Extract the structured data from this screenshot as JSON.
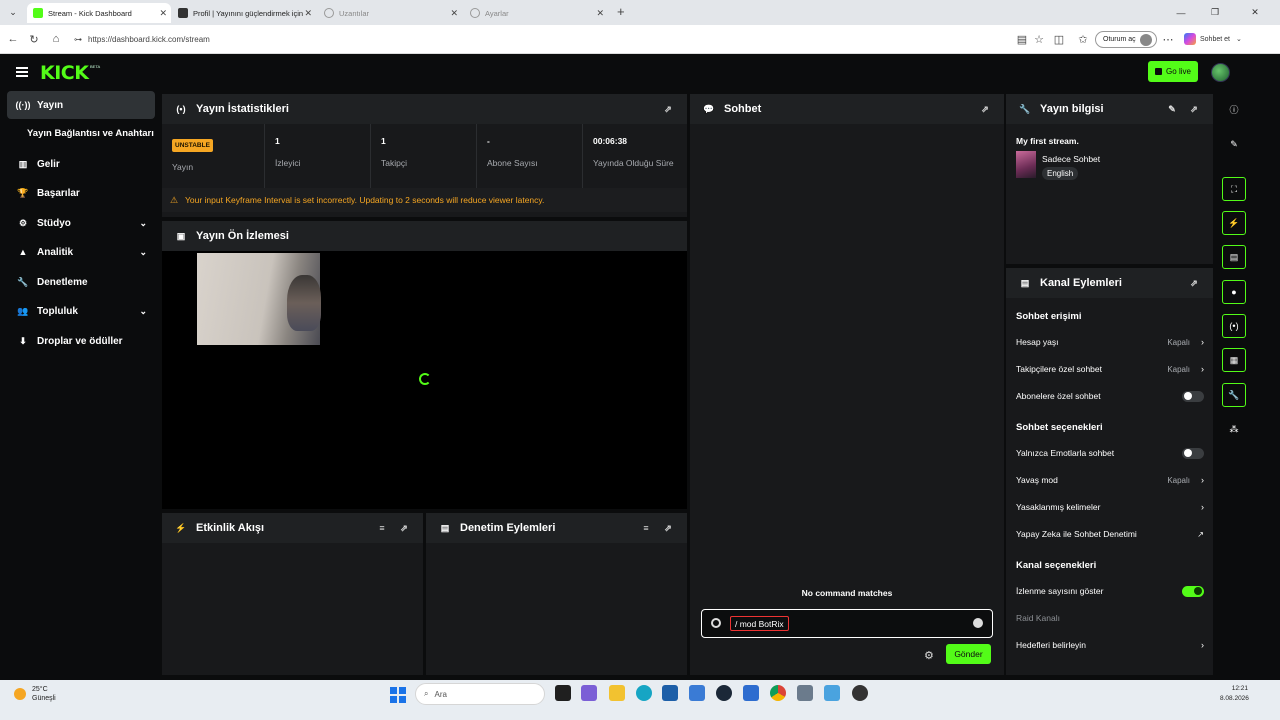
{
  "browser": {
    "tabs": [
      {
        "title": "Stream - Kick Dashboard",
        "active": true
      },
      {
        "title": "Profil | Yayınını güçlendirmek için ♪",
        "active": false
      },
      {
        "title": "Uzantılar",
        "active": false
      },
      {
        "title": "Ayarlar",
        "active": false
      }
    ],
    "url": "https://dashboard.kick.com/stream",
    "signin_label": "Oturum aç",
    "copilot_label": "Sohbet et"
  },
  "app": {
    "logo": "KICK",
    "logo_badge": "BETA",
    "go_live_label": "Go live",
    "accent_color": "#53fc18"
  },
  "sidebar": {
    "items": [
      {
        "label": "Yayın",
        "icon": "broadcast-icon",
        "active": true
      },
      {
        "label": "Yayın Bağlantısı ve Anahtarı",
        "sub": true
      },
      {
        "label": "Gelir",
        "icon": "chart-icon"
      },
      {
        "label": "Başarılar",
        "icon": "trophy-icon"
      },
      {
        "label": "Stüdyo",
        "icon": "studio-icon",
        "expandable": true
      },
      {
        "label": "Analitik",
        "icon": "analytics-icon",
        "expandable": true
      },
      {
        "label": "Denetleme",
        "icon": "wrench-icon"
      },
      {
        "label": "Topluluk",
        "icon": "community-icon",
        "expandable": true
      },
      {
        "label": "Droplar ve ödüller",
        "icon": "drops-icon"
      }
    ]
  },
  "stats_panel": {
    "title": "Yayın İstatistikleri",
    "status_badge": "UNSTABLE",
    "stats": [
      {
        "value": "",
        "label": "Yayın"
      },
      {
        "value": "1",
        "label": "İzleyici"
      },
      {
        "value": "1",
        "label": "Takipçi"
      },
      {
        "value": "-",
        "label": "Abone Sayısı"
      },
      {
        "value": "00:06:38",
        "label": "Yayında Olduğu Süre"
      }
    ],
    "warning": "Your input Keyframe Interval is set incorrectly. Updating to 2 seconds will reduce viewer latency."
  },
  "preview_panel": {
    "title": "Yayın Ön İzlemesi"
  },
  "activity_panel": {
    "title": "Etkinlik Akışı"
  },
  "moderation_panel": {
    "title": "Denetim Eylemleri"
  },
  "chat_panel": {
    "title": "Sohbet",
    "status": "No command matches",
    "input_value": "/ mod BotRix",
    "send_label": "Gönder"
  },
  "stream_info": {
    "title": "Yayın bilgisi",
    "stream_title": "My first stream.",
    "category": "Sadece Sohbet",
    "tag": "English"
  },
  "channel_actions": {
    "title": "Kanal Eylemleri",
    "sections": {
      "chat_access": "Sohbet erişimi",
      "chat_options": "Sohbet seçenekleri",
      "channel_options": "Kanal seçenekleri"
    },
    "rows": {
      "account_age": {
        "label": "Hesap yaşı",
        "value": "Kapalı"
      },
      "followers_only": {
        "label": "Takipçilere özel sohbet",
        "value": "Kapalı"
      },
      "subscribers_only": {
        "label": "Abonelere özel sohbet",
        "enabled": false
      },
      "emotes_only": {
        "label": "Yalnızca Emotlarla sohbet",
        "enabled": false
      },
      "slow_mode": {
        "label": "Yavaş mod",
        "value": "Kapalı"
      },
      "banned_words": {
        "label": "Yasaklanmış kelimeler"
      },
      "ai_moderation": {
        "label": "Yapay Zeka ile Sohbet Denetimi"
      },
      "show_views": {
        "label": "İzlenme sayısını göster",
        "enabled": true
      },
      "raid": {
        "label": "Raid Kanalı"
      },
      "goals": {
        "label": "Hedefleri belirleyin"
      }
    }
  },
  "taskbar": {
    "weather_temp": "25°C",
    "weather_desc": "Güneşli",
    "search_placeholder": "Ara",
    "time": "12:21",
    "date": "8.08.2026"
  }
}
